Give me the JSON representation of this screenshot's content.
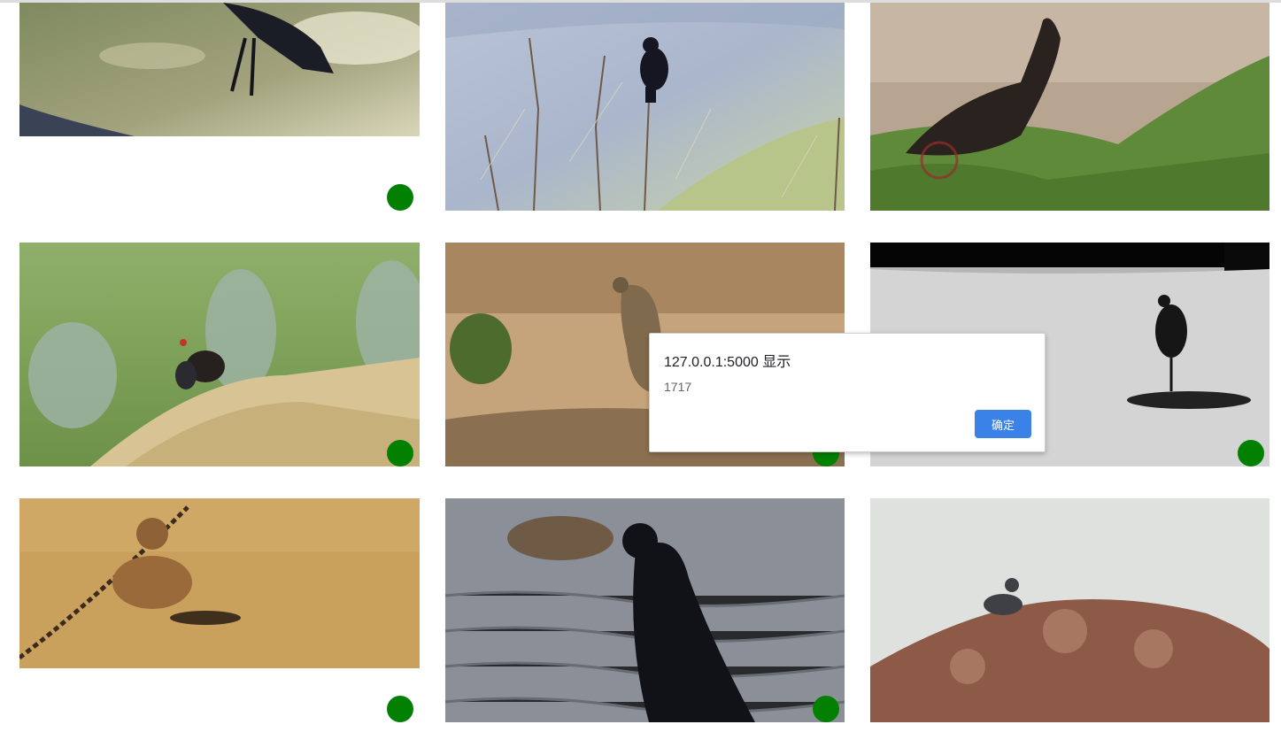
{
  "dialog": {
    "title": "127.0.0.1:5000 显示",
    "message": "1717",
    "ok_label": "确定"
  },
  "gallery": {
    "status_color": "#028002",
    "items": [
      {
        "name": "crow-on-path",
        "status": "green-dot"
      },
      {
        "name": "blackbird-on-branch",
        "status": "none"
      },
      {
        "name": "crow-in-grass",
        "status": "none"
      },
      {
        "name": "moorhen-on-sand",
        "status": "green-dot"
      },
      {
        "name": "thrasher-on-ground",
        "status": "green-dot"
      },
      {
        "name": "heron-silhouette",
        "status": "green-dot"
      },
      {
        "name": "sparrow-on-sand",
        "status": "green-dot"
      },
      {
        "name": "crow-by-water",
        "status": "green-dot"
      },
      {
        "name": "bird-on-rock",
        "status": "none"
      }
    ]
  }
}
